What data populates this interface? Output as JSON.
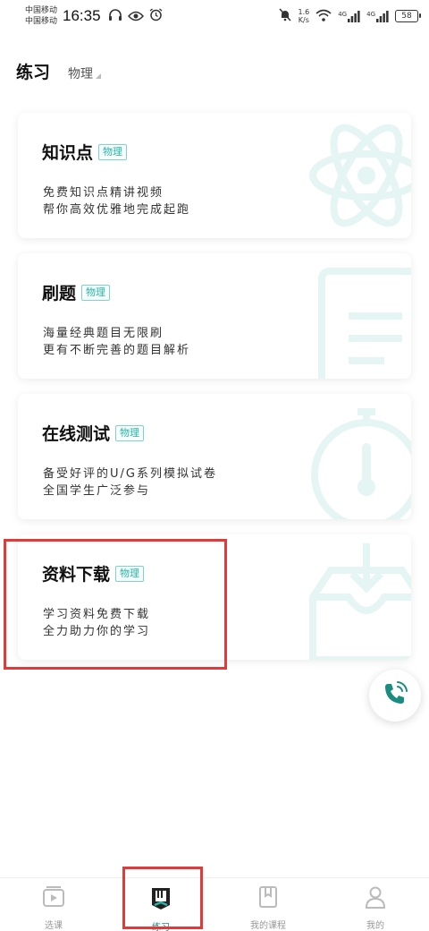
{
  "status_bar": {
    "carrier_1": "中国移动",
    "carrier_2": "中国移动",
    "time": "16:35",
    "net_speed_value": "1.6",
    "net_speed_unit": "K/s",
    "signal_1": "4G",
    "signal_2": "4G",
    "battery": "58"
  },
  "header": {
    "title": "练习",
    "subject": "物理"
  },
  "cards": [
    {
      "title": "知识点",
      "tag": "物理",
      "line1": "免费知识点精讲视频",
      "line2": "帮你高效优雅地完成起跑",
      "icon": "atom-icon"
    },
    {
      "title": "刷题",
      "tag": "物理",
      "line1": "海量经典题目无限刷",
      "line2": "更有不断完善的题目解析",
      "icon": "document-icon"
    },
    {
      "title": "在线测试",
      "tag": "物理",
      "line1": "备受好评的U/G系列模拟试卷",
      "line2": "全国学生广泛参与",
      "icon": "stopwatch-icon"
    },
    {
      "title": "资料下载",
      "tag": "物理",
      "line1": "学习资料免费下载",
      "line2": "全力助力你的学习",
      "icon": "download-box-icon"
    }
  ],
  "bottom_nav": [
    {
      "label": "选课",
      "icon": "video-play-icon",
      "active": false
    },
    {
      "label": "练习",
      "icon": "practice-book-icon",
      "active": true
    },
    {
      "label": "我的课程",
      "icon": "bookmark-book-icon",
      "active": false
    },
    {
      "label": "我的",
      "icon": "person-icon",
      "active": false
    }
  ],
  "colors": {
    "accent": "#1a8c82",
    "tag": "#2ab3a8",
    "highlight": "#e03a3a",
    "watermark": "#e4f5f3"
  }
}
